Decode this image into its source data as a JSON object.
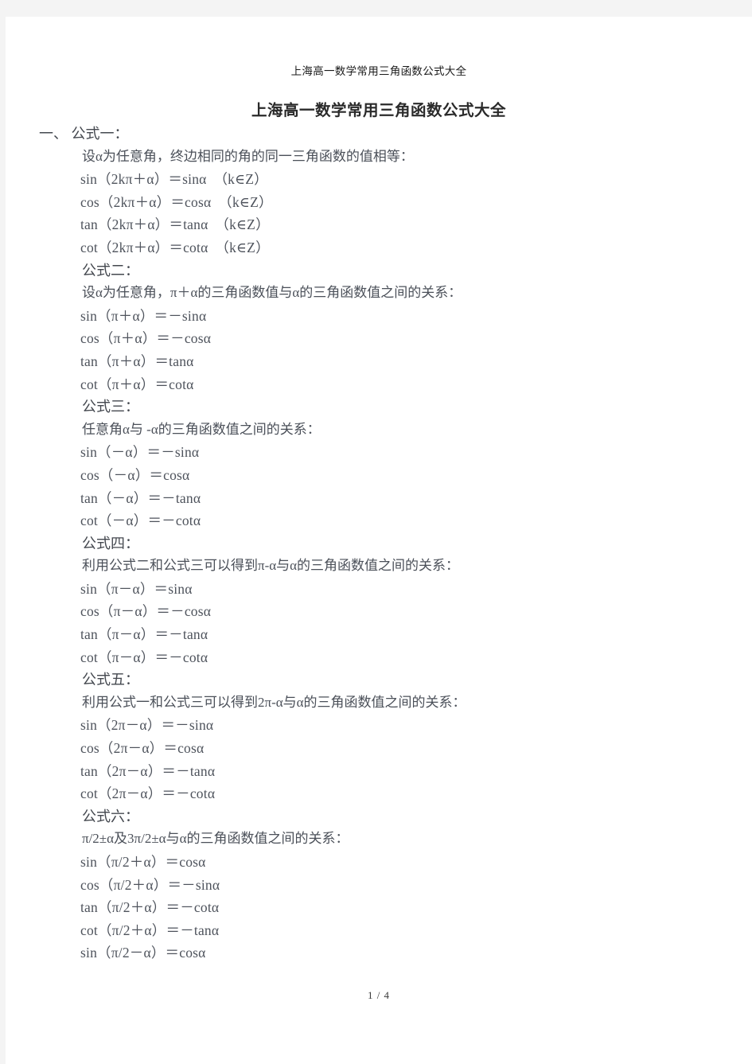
{
  "document": {
    "header_text": "上海高一数学常用三角函数公式大全",
    "title": "上海高一数学常用三角函数公式大全",
    "footer": "1 / 4"
  },
  "sections": [
    {
      "heading": "一、 公式一：",
      "description": "设α为任意角，终边相同的角的同一三角函数的值相等：",
      "formulas": [
        "sin（2kπ＋α）＝sinα　（k∈Z）",
        "cos（2kπ＋α）＝cosα　（k∈Z）",
        "tan（2kπ＋α）＝tanα　（k∈Z）",
        "cot（2kπ＋α）＝cotα　（k∈Z）"
      ]
    },
    {
      "heading": "公式二：",
      "description": "设α为任意角，π＋α的三角函数值与α的三角函数值之间的关系：",
      "formulas": [
        "sin（π＋α）＝－sinα",
        "cos（π＋α）＝－cosα",
        "tan（π＋α）＝tanα",
        "cot（π＋α）＝cotα"
      ]
    },
    {
      "heading": "公式三：",
      "description": "任意角α与 -α的三角函数值之间的关系：",
      "formulas": [
        "sin（－α）＝－sinα",
        "cos（－α）＝cosα",
        "tan（－α）＝－tanα",
        "cot（－α）＝－cotα"
      ]
    },
    {
      "heading": "公式四：",
      "description": "利用公式二和公式三可以得到π-α与α的三角函数值之间的关系：",
      "formulas": [
        "sin（π－α）＝sinα",
        "cos（π－α）＝－cosα",
        "tan（π－α）＝－tanα",
        "cot（π－α）＝－cotα"
      ]
    },
    {
      "heading": "公式五：",
      "description": "利用公式一和公式三可以得到2π-α与α的三角函数值之间的关系：",
      "formulas": [
        "sin（2π－α）＝－sinα",
        "cos（2π－α）＝cosα",
        "tan（2π－α）＝－tanα",
        "cot（2π－α）＝－cotα"
      ]
    },
    {
      "heading": "公式六：",
      "description": "π/2±α及3π/2±α与α的三角函数值之间的关系：",
      "formulas": [
        "sin（π/2＋α）＝cosα",
        "cos（π/2＋α）＝－sinα",
        "tan（π/2＋α）＝－cotα",
        "cot（π/2＋α）＝－tanα",
        "sin（π/2－α）＝cosα"
      ]
    }
  ]
}
